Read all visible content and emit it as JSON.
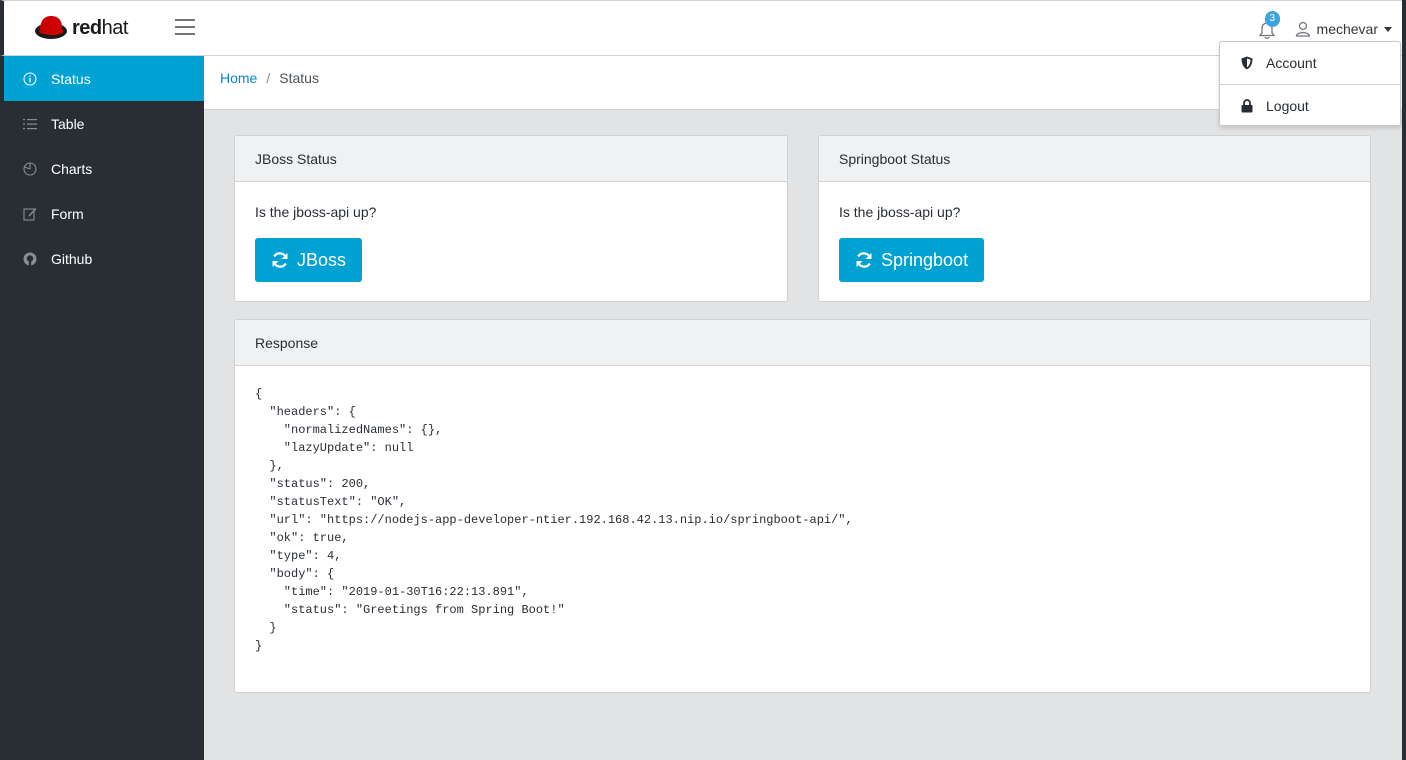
{
  "brand": {
    "text_bold": "red",
    "text_light": "hat"
  },
  "navbar": {
    "notification_count": "3",
    "username": "mechevar"
  },
  "user_menu": {
    "items": [
      {
        "label": "Account",
        "icon": "shield-icon"
      },
      {
        "label": "Logout",
        "icon": "lock-icon"
      }
    ]
  },
  "sidebar": {
    "items": [
      {
        "label": "Status",
        "icon": "info-icon",
        "active": true
      },
      {
        "label": "Table",
        "icon": "list-icon"
      },
      {
        "label": "Charts",
        "icon": "pie-chart-icon"
      },
      {
        "label": "Form",
        "icon": "edit-icon"
      },
      {
        "label": "Github",
        "icon": "github-icon"
      }
    ]
  },
  "breadcrumb": {
    "home": "Home",
    "separator": "/",
    "current": "Status"
  },
  "jboss_card": {
    "title": "JBoss Status",
    "question": "Is the jboss-api up?",
    "button_label": "JBoss"
  },
  "springboot_card": {
    "title": "Springboot Status",
    "question": "Is the jboss-api up?",
    "button_label": "Springboot"
  },
  "response_card": {
    "title": "Response",
    "body": "{\n  \"headers\": {\n    \"normalizedNames\": {},\n    \"lazyUpdate\": null\n  },\n  \"status\": 200,\n  \"statusText\": \"OK\",\n  \"url\": \"https://nodejs-app-developer-ntier.192.168.42.13.nip.io/springboot-api/\",\n  \"ok\": true,\n  \"type\": 4,\n  \"body\": {\n    \"time\": \"2019-01-30T16:22:13.891\",\n    \"status\": \"Greetings from Spring Boot!\"\n  }\n}"
  },
  "colors": {
    "accent": "#00a1d3",
    "sidebar_bg": "#292e34",
    "link": "#0088ce",
    "content_bg": "#e2e3e4"
  }
}
